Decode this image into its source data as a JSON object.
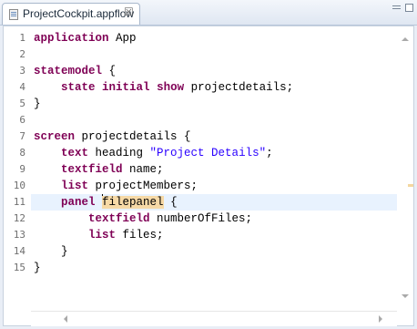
{
  "tab": {
    "title": "ProjectCockpit.appflow",
    "icon": "file-icon",
    "close_glyph": "☒"
  },
  "editor": {
    "current_line": 11,
    "lines": [
      {
        "num": "1",
        "tokens": [
          {
            "t": "application",
            "k": "kw"
          },
          {
            "t": " App",
            "k": ""
          }
        ]
      },
      {
        "num": "2",
        "tokens": []
      },
      {
        "num": "3",
        "tokens": [
          {
            "t": "statemodel",
            "k": "kw"
          },
          {
            "t": " {",
            "k": ""
          }
        ]
      },
      {
        "num": "4",
        "tokens": [
          {
            "t": "    ",
            "k": ""
          },
          {
            "t": "state",
            "k": "kw"
          },
          {
            "t": " ",
            "k": ""
          },
          {
            "t": "initial",
            "k": "kw"
          },
          {
            "t": " ",
            "k": ""
          },
          {
            "t": "show",
            "k": "kw"
          },
          {
            "t": " projectdetails;",
            "k": ""
          }
        ]
      },
      {
        "num": "5",
        "tokens": [
          {
            "t": "}",
            "k": ""
          }
        ]
      },
      {
        "num": "6",
        "tokens": []
      },
      {
        "num": "7",
        "tokens": [
          {
            "t": "screen",
            "k": "kw"
          },
          {
            "t": " projectdetails {",
            "k": ""
          }
        ]
      },
      {
        "num": "8",
        "tokens": [
          {
            "t": "    ",
            "k": ""
          },
          {
            "t": "text",
            "k": "kw"
          },
          {
            "t": " heading ",
            "k": ""
          },
          {
            "t": "\"Project Details\"",
            "k": "str"
          },
          {
            "t": ";",
            "k": ""
          }
        ]
      },
      {
        "num": "9",
        "tokens": [
          {
            "t": "    ",
            "k": ""
          },
          {
            "t": "textfield",
            "k": "kw"
          },
          {
            "t": " name;",
            "k": ""
          }
        ]
      },
      {
        "num": "10",
        "tokens": [
          {
            "t": "    ",
            "k": ""
          },
          {
            "t": "list",
            "k": "kw"
          },
          {
            "t": " projectMembers;",
            "k": ""
          }
        ]
      },
      {
        "num": "11",
        "tokens": [
          {
            "t": "    ",
            "k": ""
          },
          {
            "t": "panel",
            "k": "kw"
          },
          {
            "t": " ",
            "k": ""
          },
          {
            "t": "|",
            "k": "cursor"
          },
          {
            "t": "filepanel",
            "k": "hl"
          },
          {
            "t": " {",
            "k": ""
          }
        ]
      },
      {
        "num": "12",
        "tokens": [
          {
            "t": "        ",
            "k": ""
          },
          {
            "t": "textfield",
            "k": "kw"
          },
          {
            "t": " numberOfFiles;",
            "k": ""
          }
        ]
      },
      {
        "num": "13",
        "tokens": [
          {
            "t": "        ",
            "k": ""
          },
          {
            "t": "list",
            "k": "kw"
          },
          {
            "t": " files;",
            "k": ""
          }
        ]
      },
      {
        "num": "14",
        "tokens": [
          {
            "t": "    }",
            "k": ""
          }
        ]
      },
      {
        "num": "15",
        "tokens": [
          {
            "t": "}",
            "k": ""
          }
        ]
      }
    ]
  },
  "colors": {
    "keyword": "#7f0055",
    "string": "#2a00ff",
    "current_line_bg": "#e8f2fe",
    "occurrence_highlight": "#f6d9a6"
  }
}
